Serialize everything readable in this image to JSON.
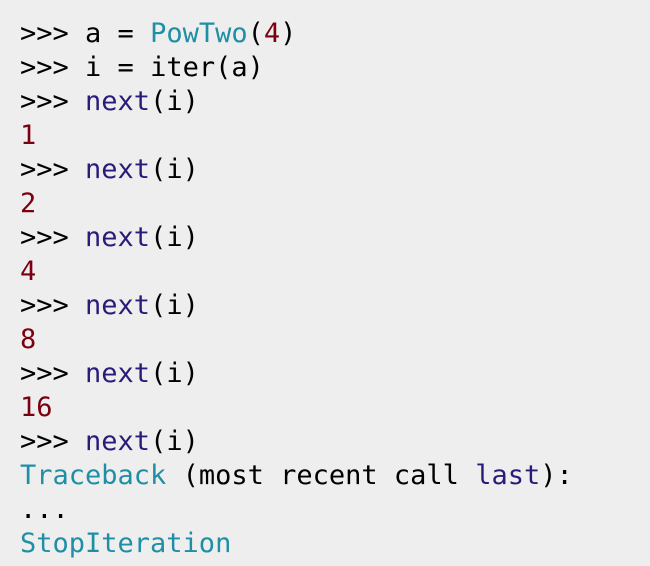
{
  "colors": {
    "background": "#eeeeee",
    "default": "#000000",
    "builtin_function": "#2c1a7a",
    "class_name": "#1f8fa6",
    "number": "#7a0010"
  },
  "console": {
    "lines": [
      {
        "kind": "input",
        "tokens": [
          {
            "text": ">>> ",
            "type": "prompt"
          },
          {
            "text": "a ",
            "type": "default"
          },
          {
            "text": "= ",
            "type": "default"
          },
          {
            "text": "PowTwo",
            "type": "cls"
          },
          {
            "text": "(",
            "type": "default"
          },
          {
            "text": "4",
            "type": "num"
          },
          {
            "text": ")",
            "type": "default"
          }
        ]
      },
      {
        "kind": "input",
        "tokens": [
          {
            "text": ">>> ",
            "type": "prompt"
          },
          {
            "text": "i ",
            "type": "default"
          },
          {
            "text": "= ",
            "type": "default"
          },
          {
            "text": "iter(a)",
            "type": "default"
          }
        ]
      },
      {
        "kind": "input",
        "tokens": [
          {
            "text": ">>> ",
            "type": "prompt"
          },
          {
            "text": "next",
            "type": "fn"
          },
          {
            "text": "(i)",
            "type": "default"
          }
        ]
      },
      {
        "kind": "output",
        "tokens": [
          {
            "text": "1",
            "type": "num"
          }
        ]
      },
      {
        "kind": "input",
        "tokens": [
          {
            "text": ">>> ",
            "type": "prompt"
          },
          {
            "text": "next",
            "type": "fn"
          },
          {
            "text": "(i)",
            "type": "default"
          }
        ]
      },
      {
        "kind": "output",
        "tokens": [
          {
            "text": "2",
            "type": "num"
          }
        ]
      },
      {
        "kind": "input",
        "tokens": [
          {
            "text": ">>> ",
            "type": "prompt"
          },
          {
            "text": "next",
            "type": "fn"
          },
          {
            "text": "(i)",
            "type": "default"
          }
        ]
      },
      {
        "kind": "output",
        "tokens": [
          {
            "text": "4",
            "type": "num"
          }
        ]
      },
      {
        "kind": "input",
        "tokens": [
          {
            "text": ">>> ",
            "type": "prompt"
          },
          {
            "text": "next",
            "type": "fn"
          },
          {
            "text": "(i)",
            "type": "default"
          }
        ]
      },
      {
        "kind": "output",
        "tokens": [
          {
            "text": "8",
            "type": "num"
          }
        ]
      },
      {
        "kind": "input",
        "tokens": [
          {
            "text": ">>> ",
            "type": "prompt"
          },
          {
            "text": "next",
            "type": "fn"
          },
          {
            "text": "(i)",
            "type": "default"
          }
        ]
      },
      {
        "kind": "output",
        "tokens": [
          {
            "text": "16",
            "type": "num"
          }
        ]
      },
      {
        "kind": "input",
        "tokens": [
          {
            "text": ">>> ",
            "type": "prompt"
          },
          {
            "text": "next",
            "type": "fn"
          },
          {
            "text": "(i)",
            "type": "default"
          }
        ]
      },
      {
        "kind": "output",
        "tokens": [
          {
            "text": "Traceback ",
            "type": "exc"
          },
          {
            "text": "(most ",
            "type": "default"
          },
          {
            "text": "recent ",
            "type": "default"
          },
          {
            "text": "call ",
            "type": "default"
          },
          {
            "text": "last",
            "type": "fn"
          },
          {
            "text": "):",
            "type": "default"
          }
        ]
      },
      {
        "kind": "output",
        "tokens": [
          {
            "text": "...",
            "type": "default"
          }
        ]
      },
      {
        "kind": "output",
        "tokens": [
          {
            "text": "StopIteration",
            "type": "exc"
          }
        ]
      }
    ]
  }
}
